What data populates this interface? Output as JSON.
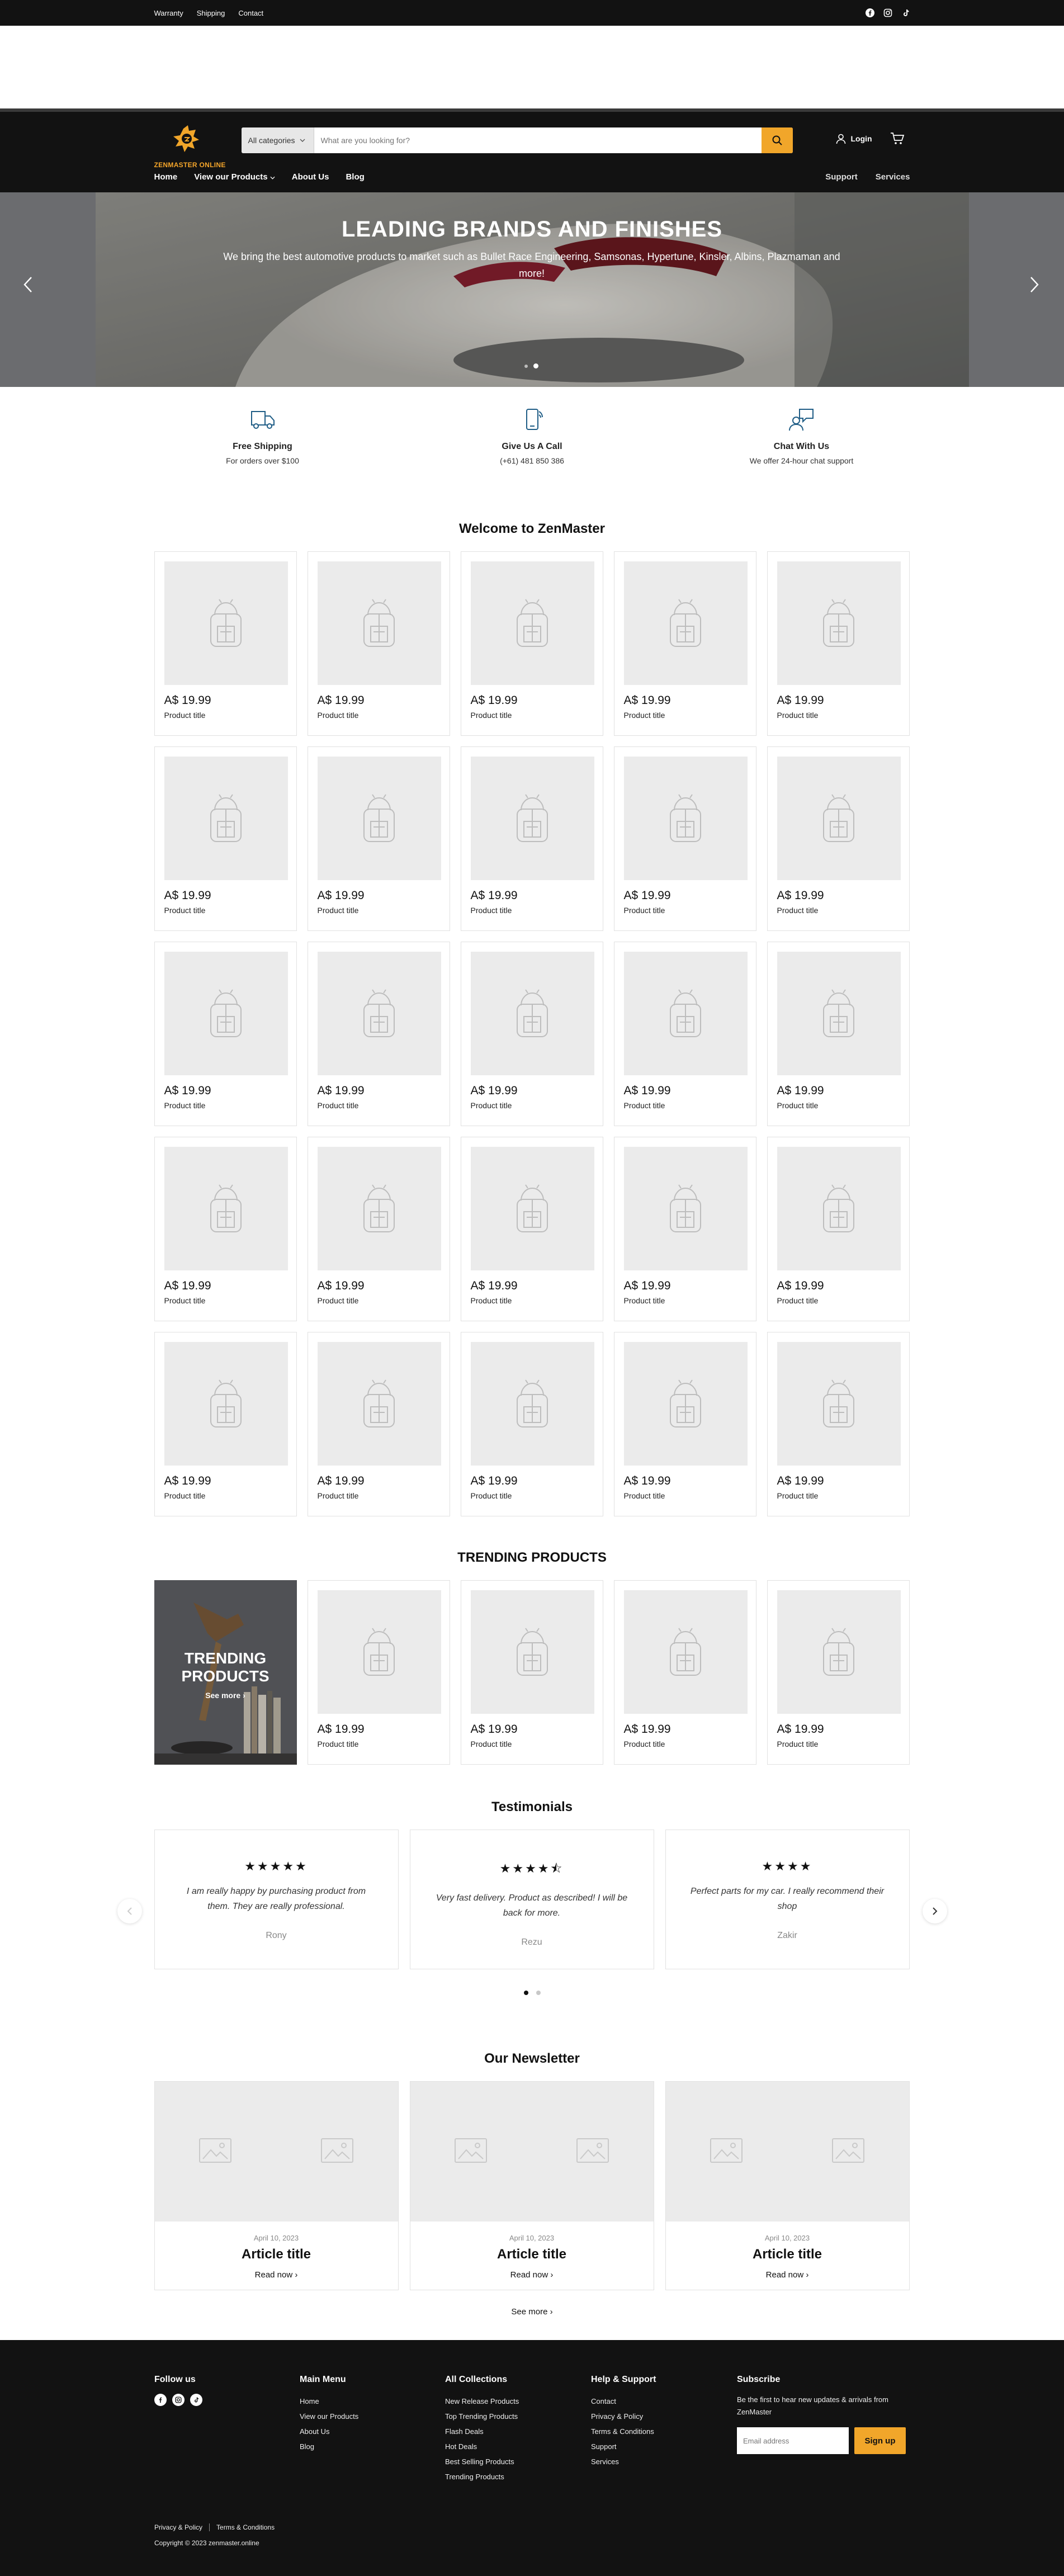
{
  "utility": {
    "links": [
      "Warranty",
      "Shipping",
      "Contact"
    ],
    "social": [
      "facebook-icon",
      "instagram-icon",
      "tiktok-icon"
    ]
  },
  "brand": {
    "logo_text": "ZENMASTER ONLINE",
    "accent": "#f1a62a"
  },
  "search": {
    "category": "All categories",
    "placeholder": "What are you looking for?"
  },
  "account": {
    "login_label": "Login"
  },
  "nav": {
    "main": [
      "Home",
      "View our Products",
      "About Us",
      "Blog"
    ],
    "secondary": [
      "Support",
      "Services"
    ]
  },
  "hero": {
    "title": "LEADING BRANDS AND FINISHES",
    "subtitle": "We bring the best automotive products to market such as Bullet Race Engineering, Samsonas, Hypertune, Kinsler, Albins, Plazmaman and more!",
    "slides": 2,
    "active_slide": 2
  },
  "features": [
    {
      "title": "Free Shipping",
      "text": "For orders over $100"
    },
    {
      "title": "Give Us A Call",
      "text": "(+61) 481 850 386"
    },
    {
      "title": "Chat With Us",
      "text": "We offer 24-hour chat support"
    }
  ],
  "welcome": {
    "title": "Welcome to ZenMaster",
    "products": [
      {
        "price": "A$ 19.99",
        "title": "Product title"
      },
      {
        "price": "A$ 19.99",
        "title": "Product title"
      },
      {
        "price": "A$ 19.99",
        "title": "Product title"
      },
      {
        "price": "A$ 19.99",
        "title": "Product title"
      },
      {
        "price": "A$ 19.99",
        "title": "Product title"
      },
      {
        "price": "A$ 19.99",
        "title": "Product title"
      },
      {
        "price": "A$ 19.99",
        "title": "Product title"
      },
      {
        "price": "A$ 19.99",
        "title": "Product title"
      },
      {
        "price": "A$ 19.99",
        "title": "Product title"
      },
      {
        "price": "A$ 19.99",
        "title": "Product title"
      },
      {
        "price": "A$ 19.99",
        "title": "Product title"
      },
      {
        "price": "A$ 19.99",
        "title": "Product title"
      },
      {
        "price": "A$ 19.99",
        "title": "Product title"
      },
      {
        "price": "A$ 19.99",
        "title": "Product title"
      },
      {
        "price": "A$ 19.99",
        "title": "Product title"
      },
      {
        "price": "A$ 19.99",
        "title": "Product title"
      },
      {
        "price": "A$ 19.99",
        "title": "Product title"
      },
      {
        "price": "A$ 19.99",
        "title": "Product title"
      },
      {
        "price": "A$ 19.99",
        "title": "Product title"
      },
      {
        "price": "A$ 19.99",
        "title": "Product title"
      },
      {
        "price": "A$ 19.99",
        "title": "Product title"
      },
      {
        "price": "A$ 19.99",
        "title": "Product title"
      },
      {
        "price": "A$ 19.99",
        "title": "Product title"
      },
      {
        "price": "A$ 19.99",
        "title": "Product title"
      },
      {
        "price": "A$ 19.99",
        "title": "Product title"
      }
    ]
  },
  "trending": {
    "title": "TRENDING PRODUCTS",
    "promo_title": "TRENDING PRODUCTS",
    "promo_link": "See more",
    "products": [
      {
        "price": "A$ 19.99",
        "title": "Product title"
      },
      {
        "price": "A$ 19.99",
        "title": "Product title"
      },
      {
        "price": "A$ 19.99",
        "title": "Product title"
      },
      {
        "price": "A$ 19.99",
        "title": "Product title"
      }
    ]
  },
  "testimonials": {
    "title": "Testimonials",
    "items": [
      {
        "rating": 5,
        "quote": "I am really happy by purchasing product from them. They are really professional.",
        "name": "Rony"
      },
      {
        "rating": 4.5,
        "quote": "Very fast delivery. Product as described! I will be back for more.",
        "name": "Rezu"
      },
      {
        "rating": 4,
        "quote": "Perfect parts for my car. I really recommend their shop",
        "name": "Zakir"
      }
    ],
    "pages": 2,
    "active_page": 1
  },
  "newsletter": {
    "title": "Our Newsletter",
    "articles": [
      {
        "date": "April 10, 2023",
        "title": "Article title",
        "link": "Read now"
      },
      {
        "date": "April 10, 2023",
        "title": "Article title",
        "link": "Read now"
      },
      {
        "date": "April 10, 2023",
        "title": "Article title",
        "link": "Read now"
      }
    ],
    "see_more": "See more"
  },
  "footer": {
    "follow": {
      "title": "Follow us"
    },
    "main_menu": {
      "title": "Main Menu",
      "links": [
        "Home",
        "View our Products",
        "About Us",
        "Blog"
      ]
    },
    "collections": {
      "title": "All Collections",
      "links": [
        "New Release Products",
        "Top Trending Products",
        "Flash Deals",
        "Hot Deals",
        "Best Selling Products",
        "Trending Products"
      ]
    },
    "help": {
      "title": "Help & Support",
      "links": [
        "Contact",
        "Privacy & Policy",
        "Terms & Conditions",
        "Support",
        "Services"
      ]
    },
    "subscribe": {
      "title": "Subscribe",
      "text": "Be the first to hear new updates & arrivals from ZenMaster",
      "placeholder": "Email address",
      "button": "Sign up"
    },
    "legal": [
      "Privacy & Policy",
      "Terms & Conditions"
    ],
    "copyright": "Copyright © 2023 zenmaster.online"
  }
}
